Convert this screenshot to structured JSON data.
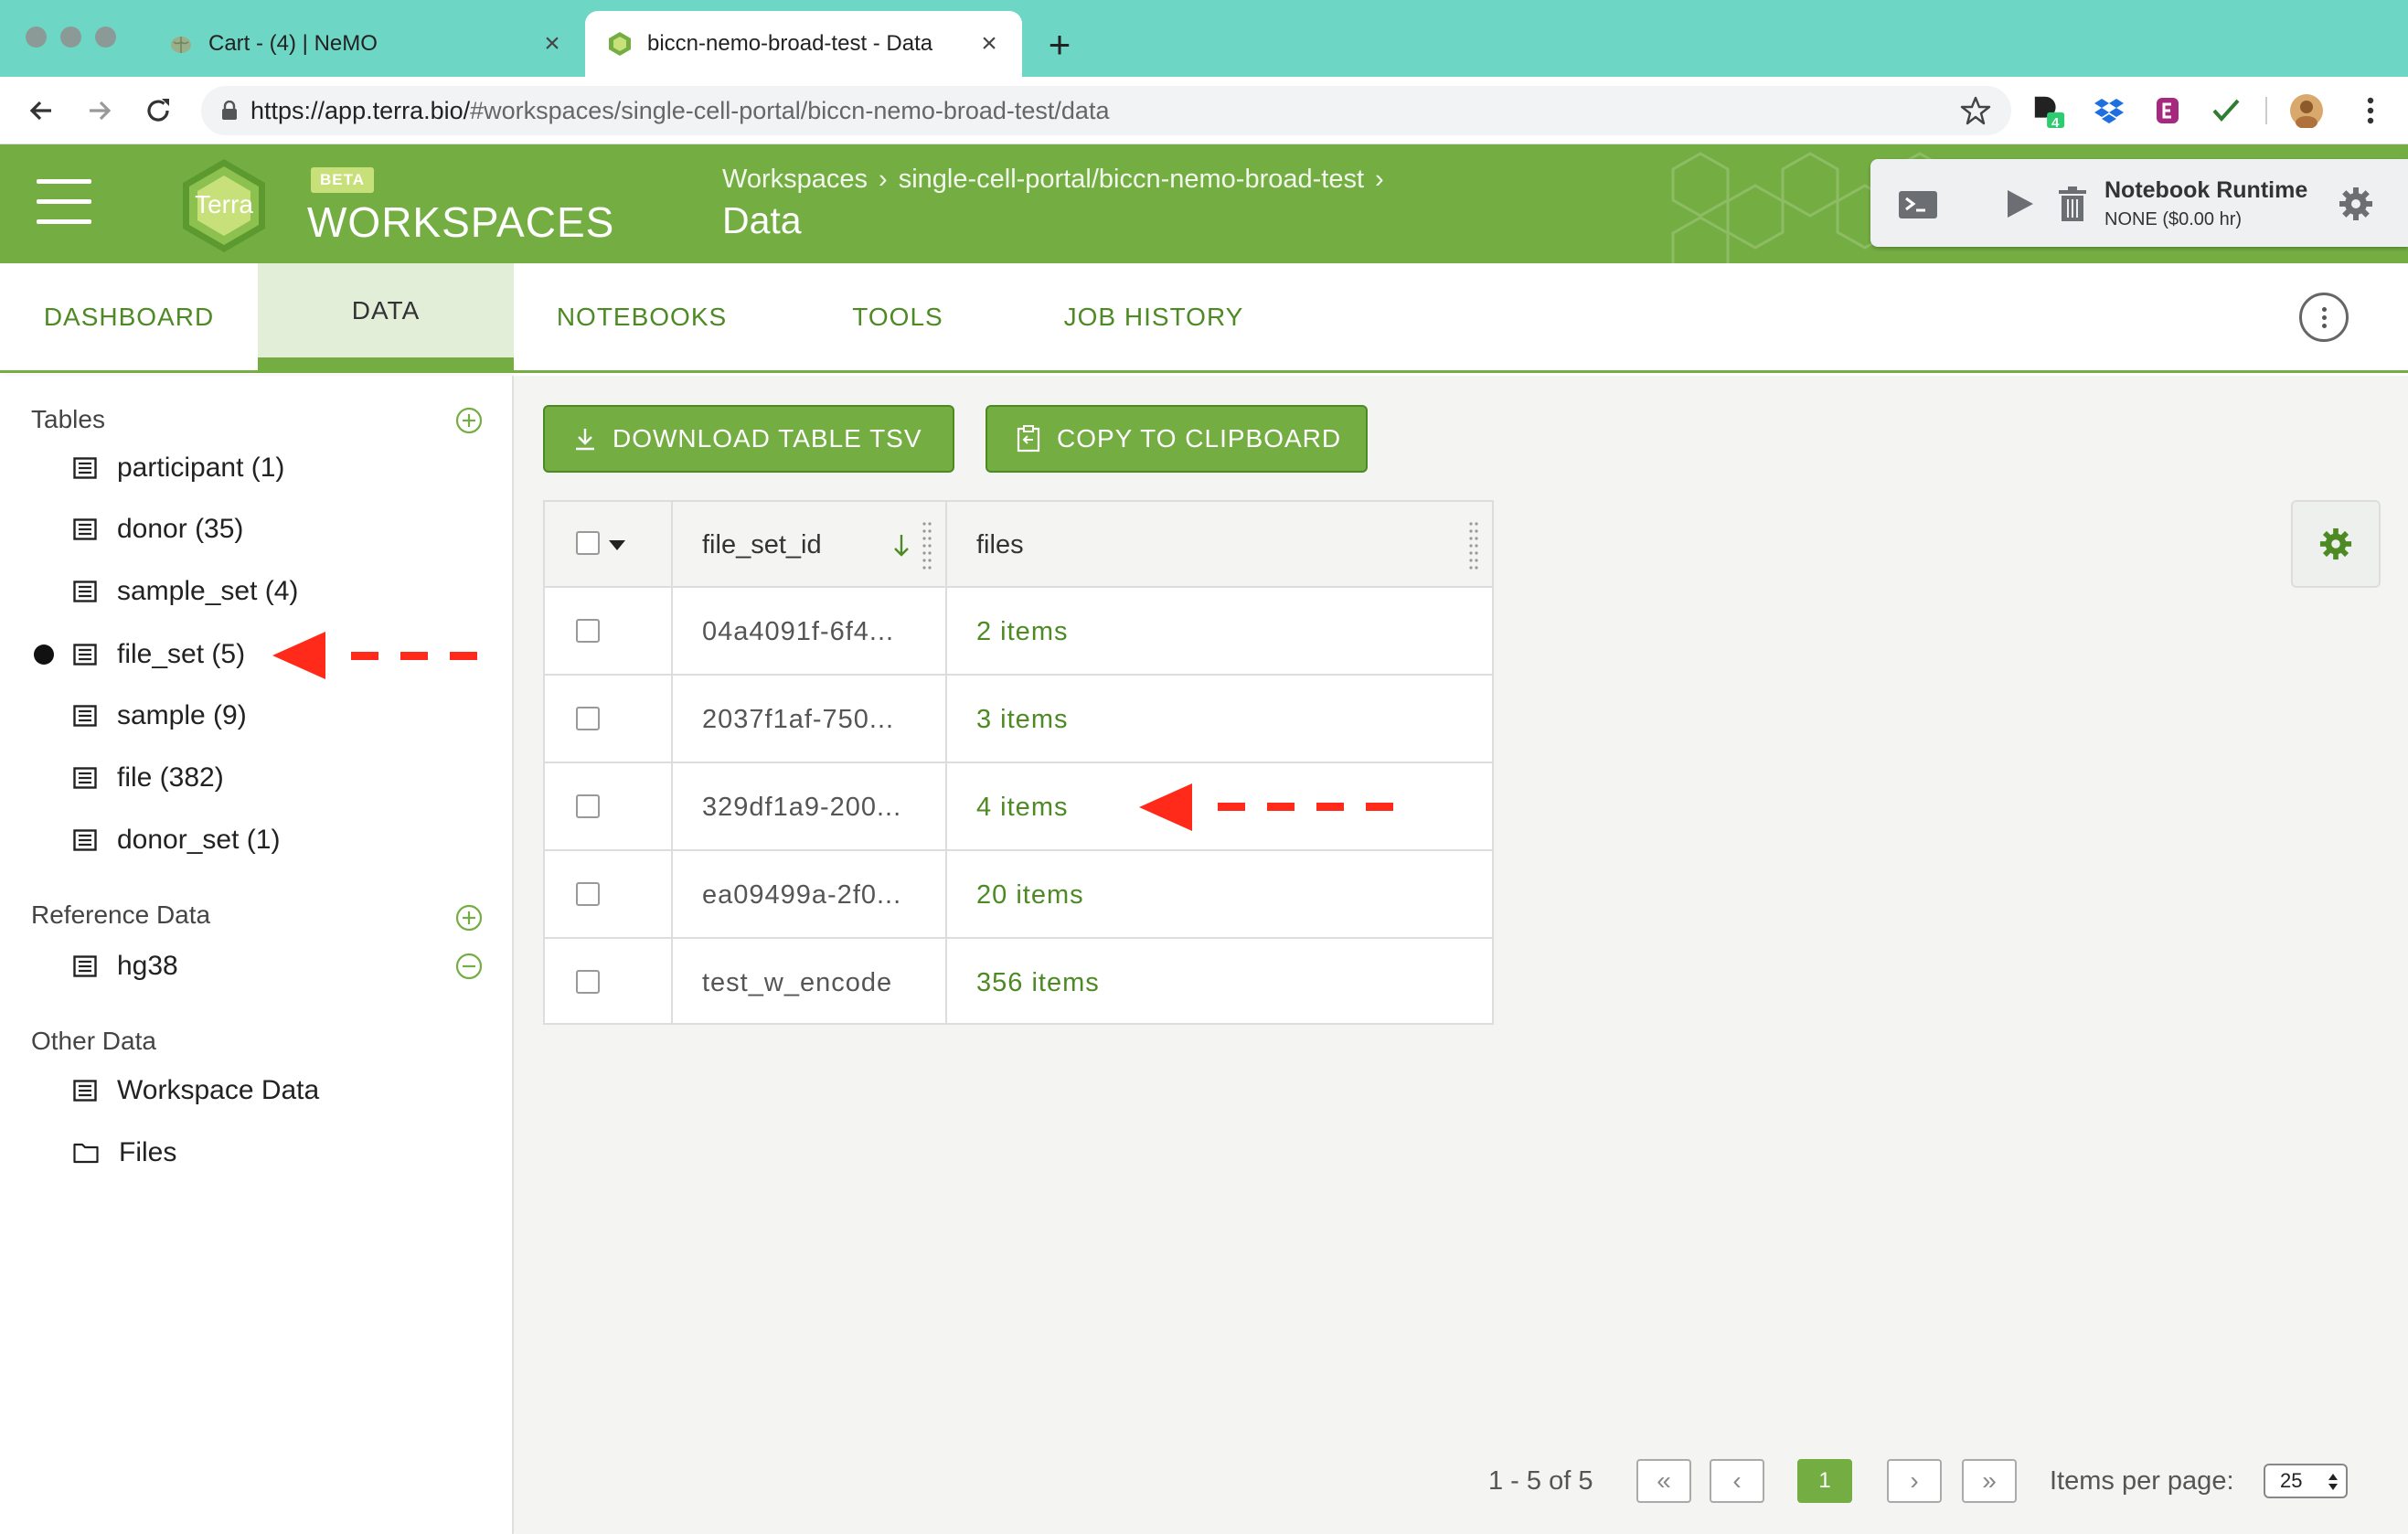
{
  "browser": {
    "tabs": [
      {
        "title": "Cart - (4) | NeMO",
        "active": false
      },
      {
        "title": "biccn-nemo-broad-test - Data",
        "active": true
      }
    ],
    "url_host": "https://app.terra.bio/",
    "url_path": "#workspaces/single-cell-portal/biccn-nemo-broad-test/data",
    "extension_badge": "4"
  },
  "header": {
    "logo_text": "Terra",
    "beta_label": "BETA",
    "app_title": "WORKSPACES",
    "breadcrumb": [
      "Workspaces",
      "single-cell-portal/biccn-nemo-broad-test"
    ],
    "breadcrumb_separator": "›",
    "page_title": "Data",
    "runtime": {
      "title": "Notebook Runtime",
      "status": "NONE ($0.00 hr)"
    }
  },
  "workspace_tabs": [
    {
      "label": "DASHBOARD",
      "active": false
    },
    {
      "label": "DATA",
      "active": true
    },
    {
      "label": "NOTEBOOKS",
      "active": false
    },
    {
      "label": "TOOLS",
      "active": false
    },
    {
      "label": "JOB HISTORY",
      "active": false
    }
  ],
  "sidebar": {
    "tables_title": "Tables",
    "tables": [
      {
        "label": "participant (1)",
        "selected": false
      },
      {
        "label": "donor (35)",
        "selected": false
      },
      {
        "label": "sample_set (4)",
        "selected": false
      },
      {
        "label": "file_set (5)",
        "selected": true
      },
      {
        "label": "sample (9)",
        "selected": false
      },
      {
        "label": "file (382)",
        "selected": false
      },
      {
        "label": "donor_set (1)",
        "selected": false
      }
    ],
    "reference_title": "Reference Data",
    "reference": [
      {
        "label": "hg38"
      }
    ],
    "other_title": "Other Data",
    "other": [
      {
        "label": "Workspace Data",
        "icon": "table-icon"
      },
      {
        "label": "Files",
        "icon": "folder-icon"
      }
    ]
  },
  "toolbar": {
    "download_label": "DOWNLOAD TABLE TSV",
    "copy_label": "COPY TO CLIPBOARD"
  },
  "table": {
    "columns": [
      "file_set_id",
      "files"
    ],
    "rows": [
      {
        "file_set_id": "04a4091f-6f4...",
        "files": "2 items"
      },
      {
        "file_set_id": "2037f1af-750...",
        "files": "3 items"
      },
      {
        "file_set_id": "329df1a9-200...",
        "files": "4 items"
      },
      {
        "file_set_id": "ea09499a-2f0...",
        "files": "20 items"
      },
      {
        "file_set_id": "test_w_encode",
        "files": "356 items"
      }
    ]
  },
  "pagination": {
    "range_text": "1 - 5 of 5",
    "first": "«",
    "prev": "‹",
    "current_page": "1",
    "next": "›",
    "last": "»",
    "items_per_page_label": "Items per page:",
    "items_per_page": "25"
  },
  "colors": {
    "terra_green": "#74ae43",
    "link_green": "#4d8a24",
    "tab_strip": "#6dd6c5",
    "annotation_red": "#ff2a1a"
  }
}
